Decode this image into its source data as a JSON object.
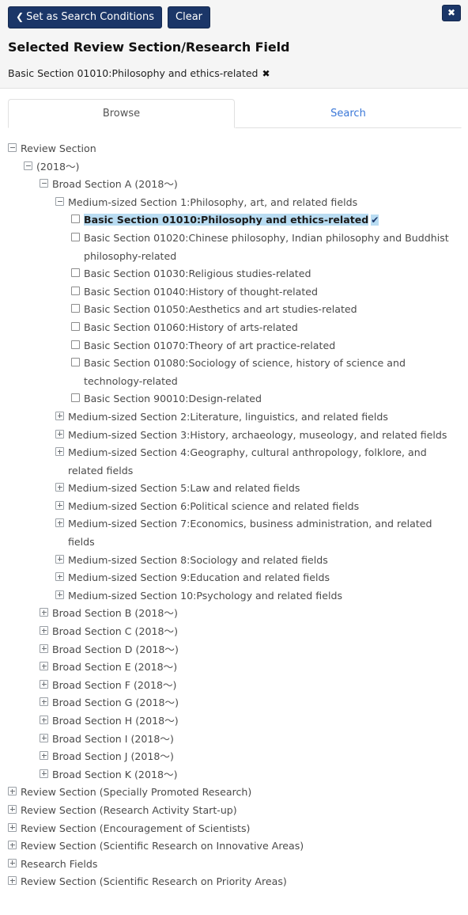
{
  "header": {
    "set_conditions_label": "Set as Search Conditions",
    "clear_label": "Clear",
    "close_label": "✖",
    "chevron": "❮",
    "title": "Selected Review Section/Research Field",
    "selected_chip": "Basic Section 01010:Philosophy and ethics-related",
    "chip_remove": "✖",
    "accent_color": "#1b3668",
    "panel_bg": "#f5f5f5"
  },
  "tabs": {
    "browse": "Browse",
    "search": "Search",
    "active": "Browse",
    "active_color": "#555555",
    "inactive_color": "#3b78d8"
  },
  "tree": {
    "check_glyph": "✔",
    "highlight_color": "#b9dcf2",
    "root": "Review Section",
    "year_group": "(2018〜)",
    "broad_section_a": "Broad Section A (2018〜)",
    "medium_section_1": "Medium-sized Section 1:Philosophy, art, and related fields",
    "basic_sections": [
      "Basic Section 01010:Philosophy and ethics-related",
      "Basic Section 01020:Chinese philosophy, Indian philosophy and Buddhist philosophy-related",
      "Basic Section 01030:Religious studies-related",
      "Basic Section 01040:History of thought-related",
      "Basic Section 01050:Aesthetics and art studies-related",
      "Basic Section 01060:History of arts-related",
      "Basic Section 01070:Theory of art practice-related",
      "Basic Section 01080:Sociology of science, history of science and technology-related",
      "Basic Section 90010:Design-related"
    ],
    "selected_basic_index": 0,
    "medium_sections": [
      "Medium-sized Section 2:Literature, linguistics, and related fields",
      "Medium-sized Section 3:History, archaeology, museology, and related fields",
      "Medium-sized Section 4:Geography, cultural anthropology, folklore, and related fields",
      "Medium-sized Section 5:Law and related fields",
      "Medium-sized Section 6:Political science and related fields",
      "Medium-sized Section 7:Economics, business administration, and related fields",
      "Medium-sized Section 8:Sociology and related fields",
      "Medium-sized Section 9:Education and related fields",
      "Medium-sized Section 10:Psychology and related fields"
    ],
    "broad_sections": [
      "Broad Section B (2018〜)",
      "Broad Section C (2018〜)",
      "Broad Section D (2018〜)",
      "Broad Section E (2018〜)",
      "Broad Section F (2018〜)",
      "Broad Section G (2018〜)",
      "Broad Section H (2018〜)",
      "Broad Section I (2018〜)",
      "Broad Section J (2018〜)",
      "Broad Section K (2018〜)"
    ],
    "top_level_others": [
      "Review Section (Specially Promoted Research)",
      "Review Section (Research Activity Start-up)",
      "Review Section (Encouragement of Scientists)",
      "Review Section (Scientific Research on Innovative Areas)",
      "Research Fields",
      "Review Section (Scientific Research on Priority Areas)"
    ]
  }
}
